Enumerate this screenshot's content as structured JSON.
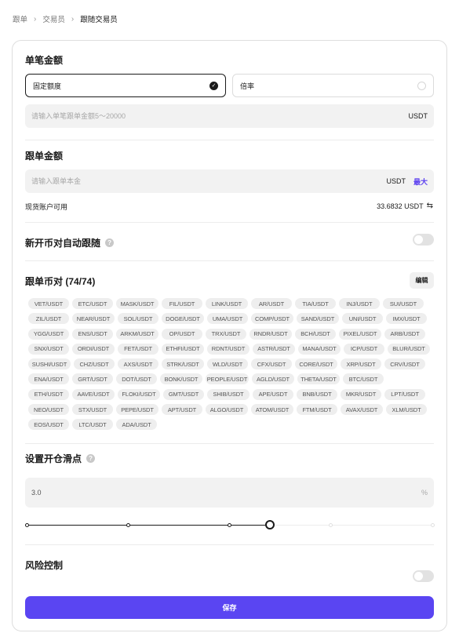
{
  "breadcrumb": [
    "跟单",
    "交易员",
    "跟随交易员"
  ],
  "amount_mode": {
    "title": "单笔金额",
    "options": [
      {
        "label": "固定额度",
        "selected": true
      },
      {
        "label": "倍率",
        "selected": false
      }
    ],
    "input_placeholder": "请输入单笔跟单金额5～20000",
    "unit": "USDT"
  },
  "follow_amount": {
    "title": "跟单金额",
    "input_placeholder": "请输入跟单本金",
    "unit": "USDT",
    "max_label": "最大",
    "available_label": "现货账户可用",
    "available_value": "33.6832 USDT"
  },
  "auto_follow": {
    "title": "新开币对自动跟随",
    "enabled": false
  },
  "pairs_section": {
    "title": "跟单币对 (74/74)",
    "edit_label": "编辑",
    "pairs": [
      "VET/USDT",
      "ETC/USDT",
      "MASK/USDT",
      "FIL/USDT",
      "LINK/USDT",
      "AR/USDT",
      "TIA/USDT",
      "INJ/USDT",
      "SUI/USDT",
      "ZIL/USDT",
      "NEAR/USDT",
      "SOL/USDT",
      "DOGE/USDT",
      "UMA/USDT",
      "COMP/USDT",
      "SAND/USDT",
      "UNI/USDT",
      "IMX/USDT",
      "YGG/USDT",
      "ENS/USDT",
      "ARKM/USDT",
      "OP/USDT",
      "TRX/USDT",
      "RNDR/USDT",
      "BCH/USDT",
      "PIXEL/USDT",
      "ARB/USDT",
      "SNX/USDT",
      "ORDI/USDT",
      "FET/USDT",
      "ETHFI/USDT",
      "RDNT/USDT",
      "ASTR/USDT",
      "MANA/USDT",
      "ICP/USDT",
      "BLUR/USDT",
      "SUSHI/USDT",
      "CHZ/USDT",
      "AXS/USDT",
      "STRK/USDT",
      "WLD/USDT",
      "CFX/USDT",
      "CORE/USDT",
      "XRP/USDT",
      "CRV/USDT",
      "ENA/USDT",
      "GRT/USDT",
      "DOT/USDT",
      "BONK/USDT",
      "PEOPLE/USDT",
      "AGLD/USDT",
      "THETA/USDT",
      "BTC/USDT",
      "ETH/USDT",
      "AAVE/USDT",
      "FLOKI/USDT",
      "GMT/USDT",
      "SHIB/USDT",
      "APE/USDT",
      "BNB/USDT",
      "MKR/USDT",
      "LPT/USDT",
      "NEO/USDT",
      "STX/USDT",
      "PEPE/USDT",
      "APT/USDT",
      "ALGO/USDT",
      "ATOM/USDT",
      "FTM/USDT",
      "AVAX/USDT",
      "XLM/USDT",
      "EOS/USDT",
      "LTC/USDT",
      "ADA/USDT"
    ],
    "rows": [
      9,
      9,
      9,
      9,
      9,
      8,
      9,
      9,
      3
    ]
  },
  "slippage": {
    "title": "设置开仓滑点",
    "value": "3.0",
    "unit": "%",
    "slider_level": 0.6,
    "slider_stops": 5
  },
  "risk_control": {
    "title": "风险控制",
    "enabled": false
  },
  "save_label": "保存",
  "colors": {
    "accent": "#5a45f2",
    "max_link": "#5a3ef0",
    "pair_bg": "#eeeeee",
    "input_bg": "#f2f2f2"
  },
  "icons": {
    "breadcrumb_sep": "chevron-right-icon",
    "check": "check-circle-icon",
    "help": "help-icon",
    "swap": "swap-icon"
  }
}
